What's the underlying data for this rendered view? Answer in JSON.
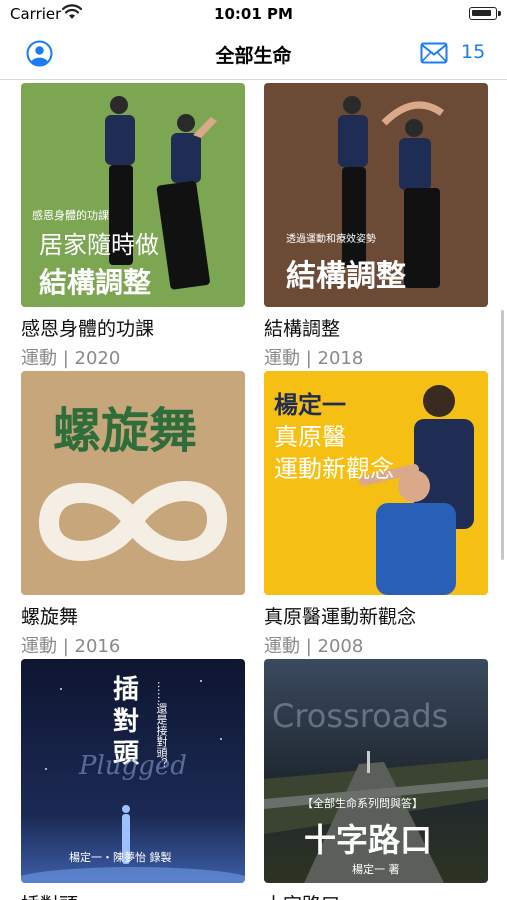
{
  "status_bar": {
    "carrier": "Carrier",
    "time": "10:01 PM"
  },
  "nav": {
    "title": "全部生命",
    "message_count": "15",
    "accent_color": "#1a7cf0"
  },
  "items": [
    {
      "title": "感恩身體的功課",
      "meta": "運動 | 2020",
      "cover": {
        "bg": "#7da653",
        "small": "感恩身體的功課",
        "line1": "居家隨時做",
        "line2": "結構調整"
      }
    },
    {
      "title": "結構調整",
      "meta": "運動 | 2018",
      "cover": {
        "bg": "#6b4a36",
        "small": "透過運動和療效姿勢",
        "line1": "結構調整"
      }
    },
    {
      "title": "螺旋舞",
      "meta": "運動 | 2016",
      "cover": {
        "bg": "#c7a67c",
        "line1": "螺旋舞"
      }
    },
    {
      "title": "真原醫運動新觀念",
      "meta": "運動 | 2008",
      "cover": {
        "bg": "#f5c013",
        "line1": "楊定一",
        "line2": "真原醫",
        "line3": "運動新觀念"
      }
    },
    {
      "title": "插對頭",
      "meta": "",
      "cover": {
        "bg": "#121a33",
        "line1": "插",
        "line2": "對",
        "line3": "頭",
        "sub": "……還是接對頭？",
        "script": "Plugged",
        "author": "楊定一・陳夢怡 錄製"
      }
    },
    {
      "title": "十字路口",
      "meta": "",
      "cover": {
        "bg": "#26303a",
        "watermark": "Crossroads",
        "series": "【全部生命系列問與答】",
        "line1": "十字路口",
        "author": "楊定一 著"
      }
    }
  ]
}
